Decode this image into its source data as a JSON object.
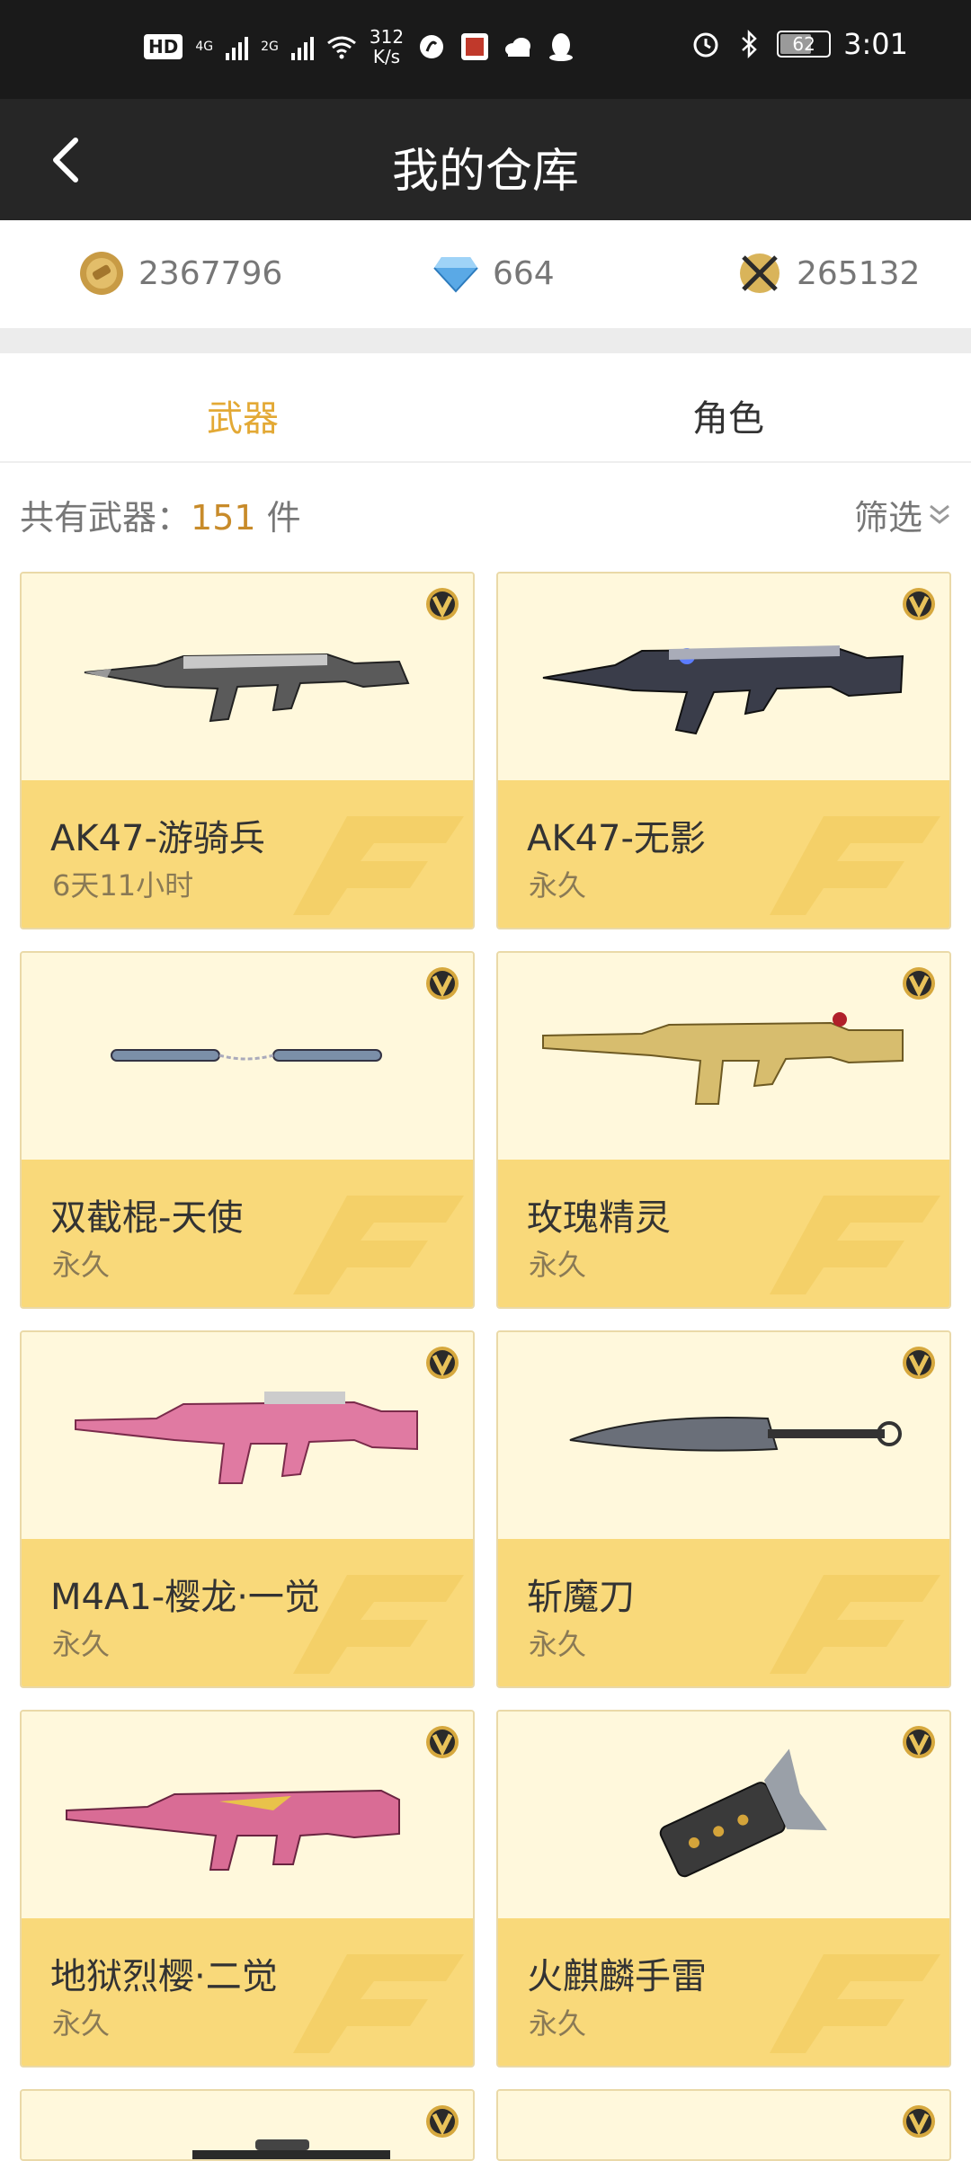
{
  "status_bar": {
    "hd": "HD",
    "sim1": "4G",
    "sim2": "2G",
    "net_speed_value": "312",
    "net_speed_unit": "K/s",
    "battery": "62",
    "time": "3:01"
  },
  "header": {
    "title": "我的仓库"
  },
  "currencies": [
    {
      "icon": "gold-coin-icon",
      "value": "2367796"
    },
    {
      "icon": "diamond-icon",
      "value": "664"
    },
    {
      "icon": "crossed-swords-coin-icon",
      "value": "265132"
    }
  ],
  "tabs": [
    {
      "label": "武器",
      "active": true
    },
    {
      "label": "角色",
      "active": false
    }
  ],
  "summary": {
    "prefix": "共有武器：",
    "count": "151",
    "suffix": " 件",
    "filter_label": "筛选"
  },
  "items": [
    {
      "name": "AK47-游骑兵",
      "duration": "6天11小时",
      "weapon": "rifle"
    },
    {
      "name": "AK47-无影",
      "duration": "永久",
      "weapon": "rifle-dark"
    },
    {
      "name": "双截棍-天使",
      "duration": "永久",
      "weapon": "nunchaku"
    },
    {
      "name": "玫瑰精灵",
      "duration": "永久",
      "weapon": "rifle-gold"
    },
    {
      "name": "M4A1-樱龙·一觉",
      "duration": "永久",
      "weapon": "rifle-pink"
    },
    {
      "name": "斩魔刀",
      "duration": "永久",
      "weapon": "blade"
    },
    {
      "name": "地狱烈樱·二觉",
      "duration": "永久",
      "weapon": "rifle-pink2"
    },
    {
      "name": "火麒麟手雷",
      "duration": "永久",
      "weapon": "grenade"
    }
  ],
  "colors": {
    "accent": "#e3a935",
    "card_bottom": "#f9d97a",
    "card_top": "#fff8dc",
    "header_bg": "#262626"
  }
}
